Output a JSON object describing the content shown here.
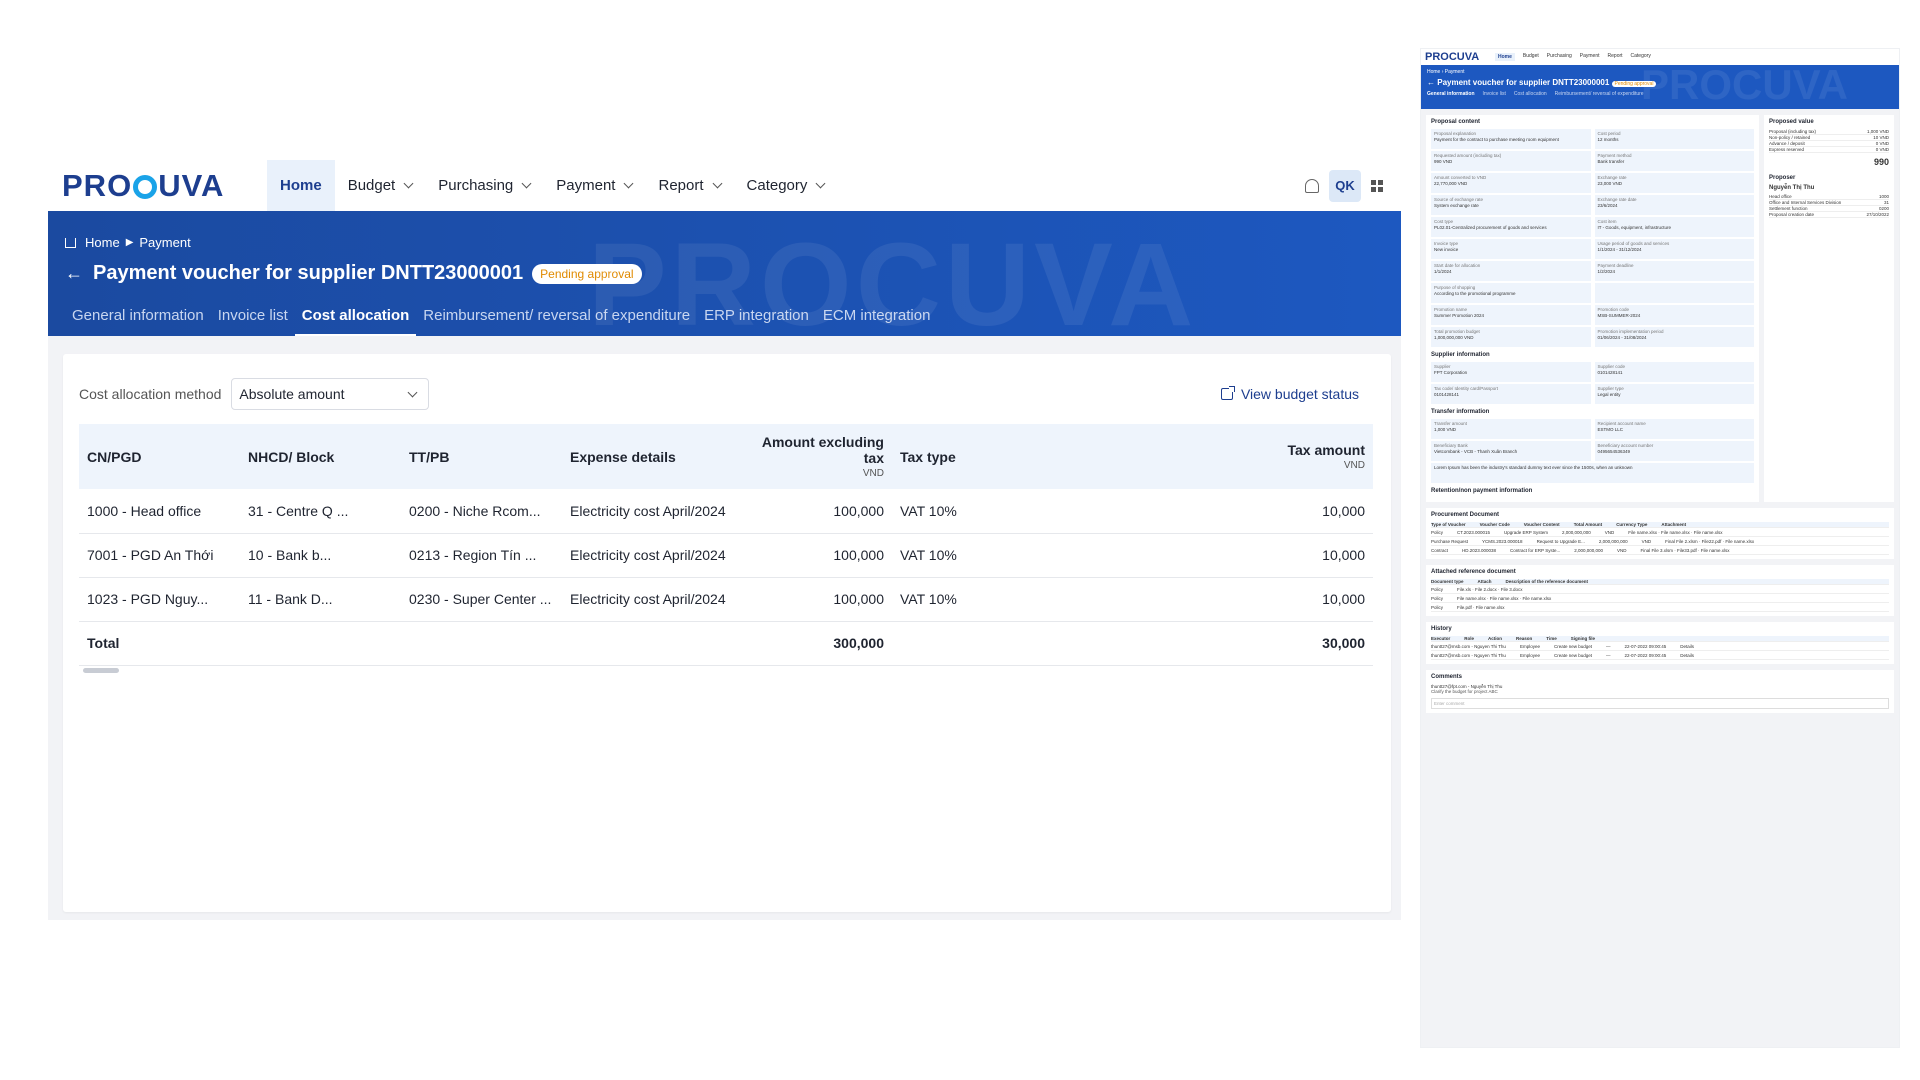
{
  "app": {
    "logo": "PROCUVA",
    "nav": [
      {
        "label": "Home",
        "active": true
      },
      {
        "label": "Budget"
      },
      {
        "label": "Purchasing"
      },
      {
        "label": "Payment"
      },
      {
        "label": "Report"
      },
      {
        "label": "Category"
      }
    ],
    "avatar_initials": "QK",
    "breadcrumb": [
      "Home",
      "Payment"
    ],
    "page_title": "Payment voucher for supplier DNTT23000001",
    "status_badge": "Pending approval",
    "tabs": [
      {
        "label": "General information"
      },
      {
        "label": "Invoice list"
      },
      {
        "label": "Cost allocation",
        "active": true
      },
      {
        "label": "Reimbursement/ reversal of expenditure"
      },
      {
        "label": "ERP integration"
      },
      {
        "label": "ECM integration"
      }
    ],
    "cost_allocation": {
      "method_label": "Cost allocation method",
      "method_value": "Absolute amount",
      "view_budget_label": "View budget status",
      "columns": {
        "cn_pgd": "CN/PGD",
        "nhcd_block": "NHCD/ Block",
        "tt_pb": "TT/PB",
        "expense_details": "Expense details",
        "amount_excl_tax": "Amount excluding tax",
        "amount_unit": "VND",
        "tax_type": "Tax type",
        "tax_amount": "Tax amount",
        "tax_unit": "VND"
      },
      "rows": [
        {
          "cn_pgd": "1000 - Head office",
          "nhcd": "31 - Centre Q ...",
          "tt_pb": "0200 - Niche Rcom...",
          "expense": "Electricity cost April/2024",
          "amount": "100,000",
          "tax_type": "VAT 10%",
          "tax_amount": "10,000"
        },
        {
          "cn_pgd": "7001 - PGD An Thới",
          "nhcd": "10 - Bank b...",
          "tt_pb": "0213 - Region Tín ...",
          "expense": "Electricity cost April/2024",
          "amount": "100,000",
          "tax_type": "VAT 10%",
          "tax_amount": "10,000"
        },
        {
          "cn_pgd": "1023 - PGD Nguy...",
          "nhcd": "11 - Bank D...",
          "tt_pb": "0230 - Super Center ...",
          "expense": "Electricity cost April/2024",
          "amount": "100,000",
          "tax_type": "VAT 10%",
          "tax_amount": "10,000"
        }
      ],
      "total_label": "Total",
      "total_amount": "300,000",
      "total_tax": "30,000"
    }
  },
  "preview": {
    "logo": "PROCUVA",
    "nav": [
      "Home",
      "Budget",
      "Purchasing",
      "Payment",
      "Report",
      "Category"
    ],
    "breadcrumb": "Home  ›  Payment",
    "title": "Payment voucher for supplier DNTT23000001",
    "badge": "Pending approval",
    "tabs": [
      "General information",
      "Invoice list",
      "Cost allocation",
      "Reimbursement/ reversal of expenditure"
    ],
    "sections": {
      "proposal_content": "Proposal content",
      "proposed_value": "Proposed value",
      "proposer": "Proposer",
      "supplier_info": "Supplier information",
      "transfer_info": "Transfer information",
      "retention": "Retention/non payment information",
      "procurement_doc": "Procurement Document",
      "attached_ref": "Attached reference document",
      "history": "History",
      "comments": "Comments"
    },
    "proposal_fields": [
      {
        "k": "Proposal explanation",
        "v": "Payment for the contract to purchase meeting room equipment"
      },
      {
        "k": "Cost period",
        "v": "12 months"
      },
      {
        "k": "Requested amount (including tax)",
        "v": "990 VND"
      },
      {
        "k": "Payment method",
        "v": "Bank transfer"
      },
      {
        "k": "Amount converted to VND",
        "v": "22,770,000 VND"
      },
      {
        "k": "Exchange rate",
        "v": "23,000 VND"
      },
      {
        "k": "Source of exchange rate",
        "v": "System exchange rate"
      },
      {
        "k": "Exchange rate date",
        "v": "23/6/2024"
      },
      {
        "k": "Cost type",
        "v": "PL02.01-Centralized procurement of goods and services"
      },
      {
        "k": "Cost item",
        "v": "IT - Goods, equipment, infrastructure"
      },
      {
        "k": "Invoice type",
        "v": "New invoice"
      },
      {
        "k": "Usage period of goods and services",
        "v": "1/1/2024 - 31/12/2024"
      },
      {
        "k": "Start date for allocation",
        "v": "1/1/2024"
      },
      {
        "k": "Payment deadline",
        "v": "1/2/2024"
      },
      {
        "k": "Purpose of shopping",
        "v": "According to the promotional programme"
      },
      {
        "k": "",
        "v": ""
      },
      {
        "k": "Promotion name",
        "v": "Summer Promotion 2024"
      },
      {
        "k": "Promotion code",
        "v": "MSB-SUMMER-2024"
      },
      {
        "k": "Total promotion budget",
        "v": "1,000,000,000 VND"
      },
      {
        "k": "Promotion implementation period",
        "v": "01/06/2024 - 31/08/2024"
      }
    ],
    "supplier_fields": [
      {
        "k": "Supplier",
        "v": "FPT Corporation"
      },
      {
        "k": "Supplier code",
        "v": "0101428141"
      },
      {
        "k": "Tax code/ Identity card/Passport",
        "v": "0101428141"
      },
      {
        "k": "Supplier type",
        "v": "Legal entity"
      }
    ],
    "transfer_fields": [
      {
        "k": "Transfer amount",
        "v": "1,000 VND"
      },
      {
        "k": "Recipient account name",
        "v": "ESTMO LLC"
      },
      {
        "k": "Beneficiary Bank",
        "v": "Vietcombank - VCB - Thanh Xuân Branch"
      },
      {
        "k": "Beneficiary account number",
        "v": "0495654536349"
      }
    ],
    "transfer_content": "Lorem Ipsum has been the industry's standard dummy text ever since the 1500s, when an unknown",
    "proposed_value_items": [
      {
        "k": "Proposal (including tax)",
        "v": "1,000 VND"
      },
      {
        "k": "Non-policy / retained",
        "v": "10 VND"
      },
      {
        "k": "Advance / deposit",
        "v": "0 VND"
      },
      {
        "k": "Express reserved",
        "v": "0 VND"
      }
    ],
    "total_request": "990",
    "proposer_name": "Nguyễn Thị Thu",
    "proposer_items": [
      {
        "k": "Head office",
        "v": "1000"
      },
      {
        "k": "Office and Internal Services Division",
        "v": "31"
      },
      {
        "k": "Settlement function",
        "v": "0200"
      },
      {
        "k": "Proposal creation date",
        "v": "27/10/2022"
      }
    ],
    "proc_headers": [
      "Type of Voucher",
      "Voucher Code",
      "Voucher Content",
      "Total Amount",
      "Currency Type",
      "Attachment"
    ],
    "proc_rows": [
      {
        "type": "Policy",
        "code": "CT.2023.000015",
        "content": "Upgrade ERP System",
        "amount": "2,000,000,000",
        "cur": "VND",
        "att": "File name.xlsx · File name.xlsx · File name.xlsx"
      },
      {
        "type": "Purchase Request",
        "code": "YCMS.2023.000018",
        "content": "Request to Upgrade E...",
        "amount": "2,000,000,000",
        "cur": "VND",
        "att": "Final File 2.xlsm · File22.pdf · File name.xlsx"
      },
      {
        "type": "Contract",
        "code": "HD.2023.000038",
        "content": "Contract for ERP Syste...",
        "amount": "2,000,000,000",
        "cur": "VND",
        "att": "Final File 3.xlsm · File33.pdf · File name.xlsx"
      }
    ],
    "ref_headers": [
      "Document type",
      "Attach",
      "Description of the reference document"
    ],
    "ref_rows": [
      {
        "type": "Policy",
        "att": "File.xls · File 2.docx · File 3.docx"
      },
      {
        "type": "Policy",
        "att": "File name.xlsx · File name.xlsx · File name.xlsx"
      },
      {
        "type": "Policy",
        "att": "File.pdf · File name.xlsx"
      }
    ],
    "history_headers": [
      "Executor",
      "Role",
      "Action",
      "Reason",
      "Time",
      "Signing file"
    ],
    "history_rows": [
      {
        "exec": "thuntt27@msb.com - Nguyen Thi Thu",
        "role": "Employee",
        "action": "Create new budget",
        "reason": "—",
        "time": "22-07-2022 09:00:45",
        "sign": "Details"
      },
      {
        "exec": "thuntt27@msb.com - Nguyen Thi Thu",
        "role": "Employee",
        "action": "Create new budget",
        "reason": "—",
        "time": "22-07-2022 09:00:45",
        "sign": "Details"
      }
    ],
    "comment_author": "thuntt27@fpt.com - Nguyễn Thị Thu",
    "comment_text": "Clarify the budget for project ABC",
    "comment_placeholder": "Enter comment"
  }
}
